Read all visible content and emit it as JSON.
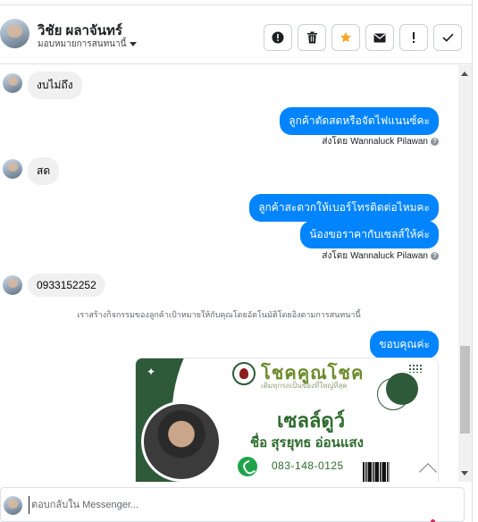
{
  "header": {
    "contact_name": "วิชัย ผลาจันทร์",
    "assign_label": "มอบหมายการสนทนานี้",
    "actions": [
      {
        "name": "spam-icon",
        "label": "!"
      },
      {
        "name": "trash-icon",
        "label": ""
      },
      {
        "name": "star-icon",
        "label": ""
      },
      {
        "name": "envelope-icon",
        "label": ""
      },
      {
        "name": "exclamation-icon",
        "label": "!"
      },
      {
        "name": "check-icon",
        "label": ""
      }
    ],
    "star_color": "#f5a623"
  },
  "messages": {
    "m1": "งบไม่ถึง",
    "m2": "ลูกค้าตัดสดหรือจัดไฟแนนซ์คะ",
    "sent_by_prefix": "ส่งโดย",
    "sender": "Wannaluck Pilawan",
    "m3": "สด",
    "m4": "ลูกค้าสะดวกให้เบอร์โทรติดต่อไหมคะ",
    "m5": "น้องขอราคากับเซลส์ให้ค่ะ",
    "m6": "0933152252",
    "system_note": "เราสร้างกิจกรรมของลูกค้าเป้าหมายให้กับคุณโดยอัตโนมัติโดยอิงตามการสนทนานี้",
    "m7": "ขอบคุณค่ะ"
  },
  "card": {
    "brand": "โชคคูณโชค",
    "tagline": "เติมทุกรถเป็นของที่ใหญ่ที่สุด",
    "title": "เซลล์ดูว์",
    "name": "ชื่อ สุรยุทธ อ่อนแสง",
    "phone": "083-148-0125"
  },
  "composer": {
    "placeholder": "ตอบกลับใน Messenger..."
  },
  "colors": {
    "outgoing_bubble": "#0084ff",
    "incoming_bubble": "#f0f0f0",
    "card_green": "#2e5a3a"
  }
}
